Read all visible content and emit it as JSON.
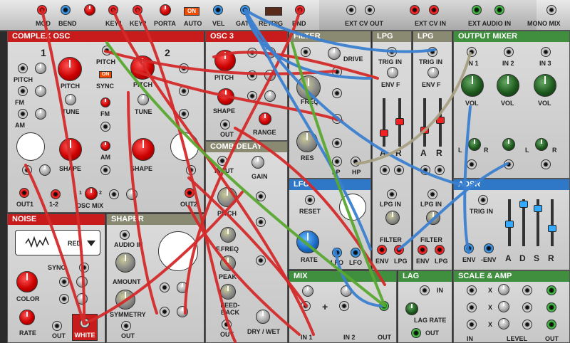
{
  "topbar": {
    "mod": "MOD",
    "bend": "BEND",
    "key1": "KEY1",
    "key2": "KEY2",
    "porta": "PORTA",
    "auto": "AUTO",
    "on": "ON",
    "vel": "VEL",
    "gate": "GATE",
    "retrig": "RETRIG",
    "rnd": "RND",
    "ext_cv_out": "EXT CV OUT",
    "ext_cv_in": "EXT CV IN",
    "ext_audio_in": "EXT AUDIO IN",
    "mono_mix": "MONO MIX"
  },
  "complex_osc": {
    "title": "COMPLEX OSC",
    "osc1": "1",
    "osc2": "2",
    "pitch_l": "PITCH",
    "fm_l": "FM",
    "am_l": "AM",
    "pitch": "PITCH",
    "tune": "TUNE",
    "shape": "SHAPE",
    "pitch_c": "PITCH",
    "sync": "SYNC",
    "on": "ON",
    "fm_c": "FM",
    "am_c": "AM",
    "pitch2": "PITCH",
    "tune2": "TUNE",
    "shape2": "SHAPE",
    "out1": "OUT1",
    "mix12": "1-2",
    "osc_mix_1": "1",
    "osc_mix_2": "2",
    "osc_mix": "OSC MIX",
    "out2": "OUT2"
  },
  "osc3": {
    "title": "OSC 3",
    "pitch": "PITCH",
    "shape": "SHAPE",
    "out": "OUT",
    "range": "RANGE"
  },
  "combdelay": {
    "title": "COMB DELAY",
    "input": "INPUT",
    "gain": "GAIN",
    "pitch": "PITCH",
    "ffreq": "F.FREQ",
    "peak": "PEAK",
    "feedback": "FEED-BACK",
    "out": "OUT",
    "drywet": "DRY / WET"
  },
  "filter": {
    "title": "FILTER",
    "drive": "DRIVE",
    "freq": "FREQ",
    "res": "RES",
    "lp": "LP",
    "hp": "HP"
  },
  "lpg1": {
    "title": "LPG",
    "trig_in": "TRIG IN",
    "env_f": "ENV F",
    "a": "A",
    "r": "R",
    "lpg_in": "LPG IN",
    "filter": "FILTER",
    "env": "ENV",
    "lpg": "LPG"
  },
  "lpg2": {
    "title": "LPG",
    "trig_in": "TRIG IN",
    "env_f": "ENV F",
    "a": "A",
    "r": "R",
    "lpg_in": "LPG IN",
    "filter": "FILTER",
    "env": "ENV",
    "lpg": "LPG"
  },
  "output_mixer": {
    "title": "OUTPUT MIXER",
    "in1": "IN 1",
    "in2": "IN 2",
    "in3": "IN 3",
    "vol": "VOL",
    "l": "L",
    "r": "R"
  },
  "adsr": {
    "title": "ADSR",
    "trig_in": "TRIG IN",
    "env": "ENV",
    "neg_env": "-ENV",
    "a": "A",
    "d": "D",
    "s": "S",
    "r": "R"
  },
  "noise": {
    "title": "NOISE",
    "red": "RED",
    "sync": "SYNC",
    "color": "COLOR",
    "rate": "RATE",
    "out": "OUT",
    "white": "WHITE"
  },
  "shaper": {
    "title": "SHAPER",
    "audio_in": "AUDIO IN",
    "amount": "AMOUNT",
    "symmetry": "SYMMETRY",
    "out": "OUT"
  },
  "lfo": {
    "title": "LFO",
    "reset": "RESET",
    "rate": "RATE",
    "lfo_a": "LFO",
    "lfo_b": "LFO"
  },
  "mix": {
    "title": "MIX",
    "in1": "IN 1",
    "in2": "IN 2",
    "out": "OUT",
    "plus": "+"
  },
  "lag": {
    "title": "LAG",
    "in": "IN",
    "lag_rate": "LAG RATE",
    "out": "OUT"
  },
  "scale_amp": {
    "title": "SCALE & AMP",
    "x": "X",
    "in": "IN",
    "level": "LEVEL",
    "out": "OUT"
  },
  "colors": {
    "red_cable": "#d42a2a",
    "blue_cable": "#3b7fd0",
    "green_cable": "#5aa830",
    "tan_cable": "#a8a084",
    "header_red": "#c81c1c",
    "header_blue": "#2f78c8",
    "header_green": "#3f8f3f"
  }
}
